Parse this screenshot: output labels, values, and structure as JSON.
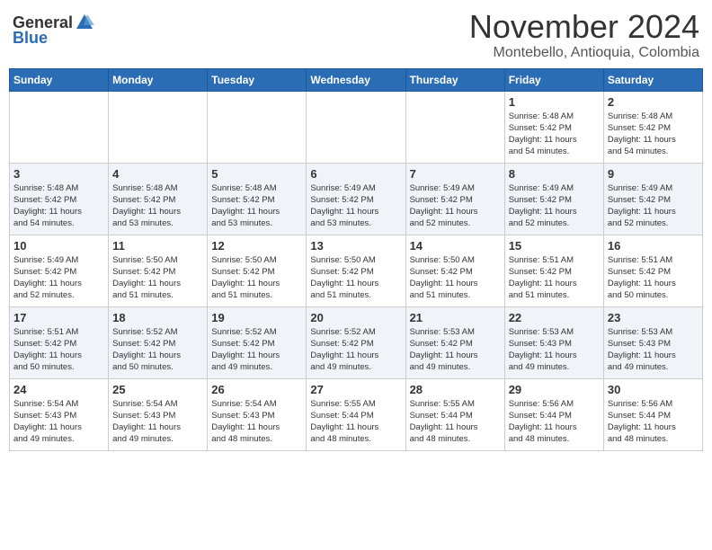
{
  "header": {
    "logo_general": "General",
    "logo_blue": "Blue",
    "month_title": "November 2024",
    "location": "Montebello, Antioquia, Colombia"
  },
  "days_of_week": [
    "Sunday",
    "Monday",
    "Tuesday",
    "Wednesday",
    "Thursday",
    "Friday",
    "Saturday"
  ],
  "weeks": [
    [
      {
        "day": "",
        "info": ""
      },
      {
        "day": "",
        "info": ""
      },
      {
        "day": "",
        "info": ""
      },
      {
        "day": "",
        "info": ""
      },
      {
        "day": "",
        "info": ""
      },
      {
        "day": "1",
        "info": "Sunrise: 5:48 AM\nSunset: 5:42 PM\nDaylight: 11 hours\nand 54 minutes."
      },
      {
        "day": "2",
        "info": "Sunrise: 5:48 AM\nSunset: 5:42 PM\nDaylight: 11 hours\nand 54 minutes."
      }
    ],
    [
      {
        "day": "3",
        "info": "Sunrise: 5:48 AM\nSunset: 5:42 PM\nDaylight: 11 hours\nand 54 minutes."
      },
      {
        "day": "4",
        "info": "Sunrise: 5:48 AM\nSunset: 5:42 PM\nDaylight: 11 hours\nand 53 minutes."
      },
      {
        "day": "5",
        "info": "Sunrise: 5:48 AM\nSunset: 5:42 PM\nDaylight: 11 hours\nand 53 minutes."
      },
      {
        "day": "6",
        "info": "Sunrise: 5:49 AM\nSunset: 5:42 PM\nDaylight: 11 hours\nand 53 minutes."
      },
      {
        "day": "7",
        "info": "Sunrise: 5:49 AM\nSunset: 5:42 PM\nDaylight: 11 hours\nand 52 minutes."
      },
      {
        "day": "8",
        "info": "Sunrise: 5:49 AM\nSunset: 5:42 PM\nDaylight: 11 hours\nand 52 minutes."
      },
      {
        "day": "9",
        "info": "Sunrise: 5:49 AM\nSunset: 5:42 PM\nDaylight: 11 hours\nand 52 minutes."
      }
    ],
    [
      {
        "day": "10",
        "info": "Sunrise: 5:49 AM\nSunset: 5:42 PM\nDaylight: 11 hours\nand 52 minutes."
      },
      {
        "day": "11",
        "info": "Sunrise: 5:50 AM\nSunset: 5:42 PM\nDaylight: 11 hours\nand 51 minutes."
      },
      {
        "day": "12",
        "info": "Sunrise: 5:50 AM\nSunset: 5:42 PM\nDaylight: 11 hours\nand 51 minutes."
      },
      {
        "day": "13",
        "info": "Sunrise: 5:50 AM\nSunset: 5:42 PM\nDaylight: 11 hours\nand 51 minutes."
      },
      {
        "day": "14",
        "info": "Sunrise: 5:50 AM\nSunset: 5:42 PM\nDaylight: 11 hours\nand 51 minutes."
      },
      {
        "day": "15",
        "info": "Sunrise: 5:51 AM\nSunset: 5:42 PM\nDaylight: 11 hours\nand 51 minutes."
      },
      {
        "day": "16",
        "info": "Sunrise: 5:51 AM\nSunset: 5:42 PM\nDaylight: 11 hours\nand 50 minutes."
      }
    ],
    [
      {
        "day": "17",
        "info": "Sunrise: 5:51 AM\nSunset: 5:42 PM\nDaylight: 11 hours\nand 50 minutes."
      },
      {
        "day": "18",
        "info": "Sunrise: 5:52 AM\nSunset: 5:42 PM\nDaylight: 11 hours\nand 50 minutes."
      },
      {
        "day": "19",
        "info": "Sunrise: 5:52 AM\nSunset: 5:42 PM\nDaylight: 11 hours\nand 49 minutes."
      },
      {
        "day": "20",
        "info": "Sunrise: 5:52 AM\nSunset: 5:42 PM\nDaylight: 11 hours\nand 49 minutes."
      },
      {
        "day": "21",
        "info": "Sunrise: 5:53 AM\nSunset: 5:42 PM\nDaylight: 11 hours\nand 49 minutes."
      },
      {
        "day": "22",
        "info": "Sunrise: 5:53 AM\nSunset: 5:43 PM\nDaylight: 11 hours\nand 49 minutes."
      },
      {
        "day": "23",
        "info": "Sunrise: 5:53 AM\nSunset: 5:43 PM\nDaylight: 11 hours\nand 49 minutes."
      }
    ],
    [
      {
        "day": "24",
        "info": "Sunrise: 5:54 AM\nSunset: 5:43 PM\nDaylight: 11 hours\nand 49 minutes."
      },
      {
        "day": "25",
        "info": "Sunrise: 5:54 AM\nSunset: 5:43 PM\nDaylight: 11 hours\nand 49 minutes."
      },
      {
        "day": "26",
        "info": "Sunrise: 5:54 AM\nSunset: 5:43 PM\nDaylight: 11 hours\nand 48 minutes."
      },
      {
        "day": "27",
        "info": "Sunrise: 5:55 AM\nSunset: 5:44 PM\nDaylight: 11 hours\nand 48 minutes."
      },
      {
        "day": "28",
        "info": "Sunrise: 5:55 AM\nSunset: 5:44 PM\nDaylight: 11 hours\nand 48 minutes."
      },
      {
        "day": "29",
        "info": "Sunrise: 5:56 AM\nSunset: 5:44 PM\nDaylight: 11 hours\nand 48 minutes."
      },
      {
        "day": "30",
        "info": "Sunrise: 5:56 AM\nSunset: 5:44 PM\nDaylight: 11 hours\nand 48 minutes."
      }
    ]
  ]
}
